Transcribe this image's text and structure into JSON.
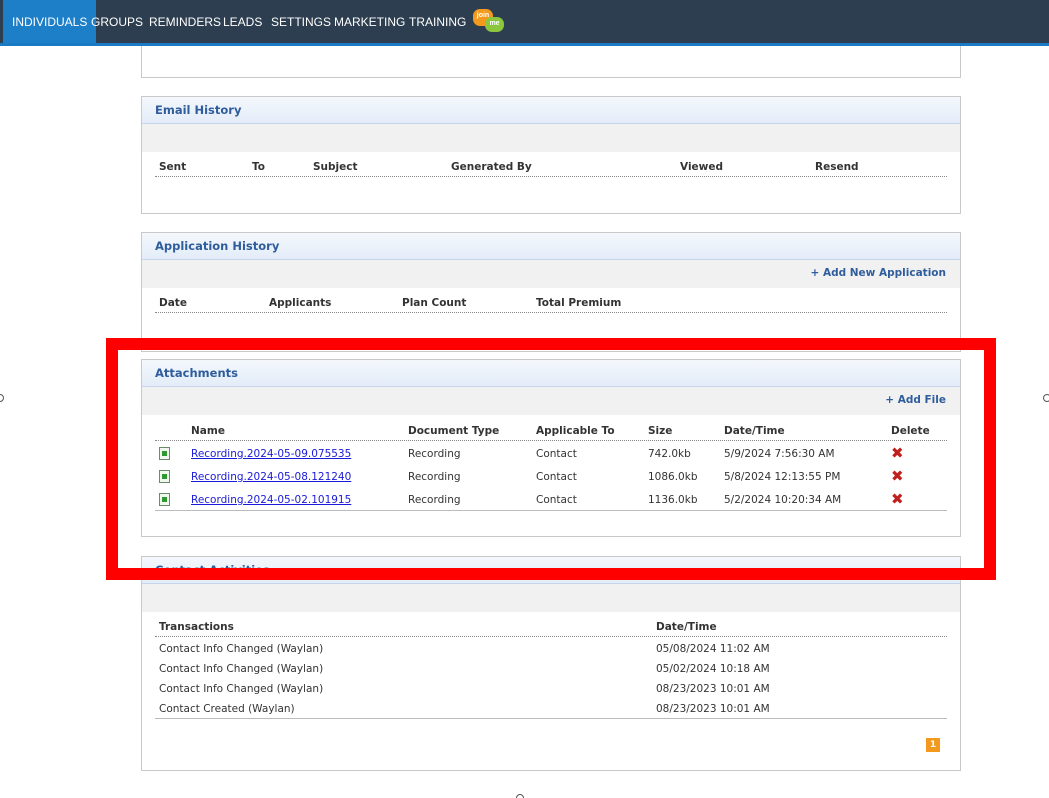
{
  "nav": {
    "tabs": [
      "INDIVIDUALS",
      "GROUPS",
      "REMINDERS",
      "LEADS",
      "SETTINGS",
      "MARKETING",
      "TRAINING"
    ],
    "logo_text_top": "join",
    "logo_text_bottom": "me"
  },
  "email_history": {
    "title": "Email History",
    "columns": [
      "Sent",
      "To",
      "Subject",
      "Generated By",
      "Viewed",
      "Resend"
    ]
  },
  "application_history": {
    "title": "Application History",
    "add_label": "+ Add New Application",
    "columns": [
      "Date",
      "Applicants",
      "Plan Count",
      "Total Premium"
    ]
  },
  "attachments": {
    "title": "Attachments",
    "add_label": "+ Add File",
    "columns": [
      "Name",
      "Document Type",
      "Applicable To",
      "Size",
      "Date/Time",
      "Delete"
    ],
    "rows": [
      {
        "name": "Recording.2024-05-09.075535",
        "type": "Recording",
        "applicable": "Contact",
        "size": "742.0kb",
        "datetime": "5/9/2024 7:56:30 AM",
        "delete": "✖"
      },
      {
        "name": "Recording.2024-05-08.121240",
        "type": "Recording",
        "applicable": "Contact",
        "size": "1086.0kb",
        "datetime": "5/8/2024 12:13:55 PM",
        "delete": "✖"
      },
      {
        "name": "Recording.2024-05-02.101915",
        "type": "Recording",
        "applicable": "Contact",
        "size": "1136.0kb",
        "datetime": "5/2/2024 10:20:34 AM",
        "delete": "✖"
      }
    ]
  },
  "contact_activities": {
    "title": "Contact Activities",
    "columns": [
      "Transactions",
      "Date/Time"
    ],
    "rows": [
      {
        "transaction": "Contact Info Changed (Waylan)",
        "datetime": "05/08/2024 11:02 AM"
      },
      {
        "transaction": "Contact Info Changed (Waylan)",
        "datetime": "05/02/2024 10:18 AM"
      },
      {
        "transaction": "Contact Info Changed (Waylan)",
        "datetime": "08/23/2023 10:01 AM"
      },
      {
        "transaction": "Contact Created (Waylan)",
        "datetime": "08/23/2023 10:01 AM"
      }
    ],
    "page": "1"
  },
  "colors": {
    "nav_bg": "#2c3e4f",
    "nav_active": "#1e7fc9",
    "panel_title": "#2f5d9c",
    "highlight": "#ff0000",
    "delete": "#c0201e",
    "pager": "#f39a1e"
  }
}
